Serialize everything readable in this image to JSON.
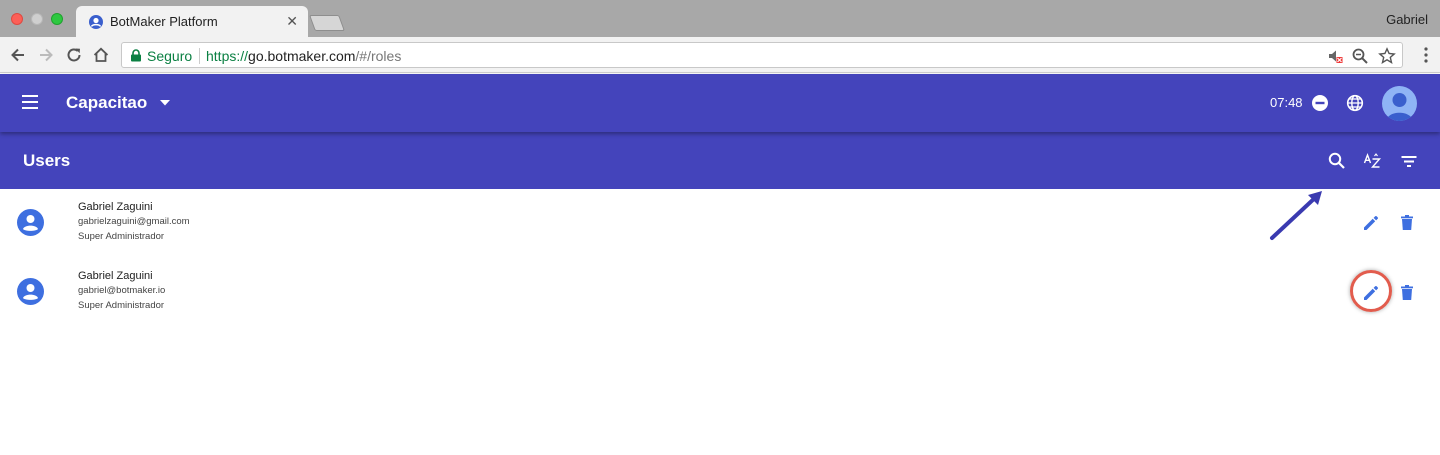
{
  "browser": {
    "tab_title": "BotMaker Platform",
    "tab_close": "✕",
    "profile_name": "Gabriel",
    "secure_label": "Seguro",
    "url_scheme": "https://",
    "url_host": "go.botmaker.com",
    "url_path": "/#/roles"
  },
  "header": {
    "workspace": "Capacitao",
    "time": "07:48"
  },
  "subheader": {
    "title": "Users"
  },
  "users": [
    {
      "name": "Gabriel Zaguini",
      "email": "gabrielzaguini@gmail.com",
      "role": "Super Administrador"
    },
    {
      "name": "Gabriel Zaguini",
      "email": "gabriel@botmaker.io",
      "role": "Super Administrador"
    }
  ],
  "colors": {
    "appbar": "#4444bb",
    "action_blue": "#3e6fe0",
    "highlight": "#e25c4d",
    "annotation_arrow": "#3a3ab0"
  },
  "icons": {
    "menu": "menu-icon",
    "workspace_dropdown": "chevron-down-icon",
    "status": "minus-circle-icon",
    "language": "globe-icon",
    "search": "search-icon",
    "sort": "sort-az-icon",
    "filter": "filter-icon",
    "edit": "pencil-icon",
    "delete": "trash-icon"
  }
}
